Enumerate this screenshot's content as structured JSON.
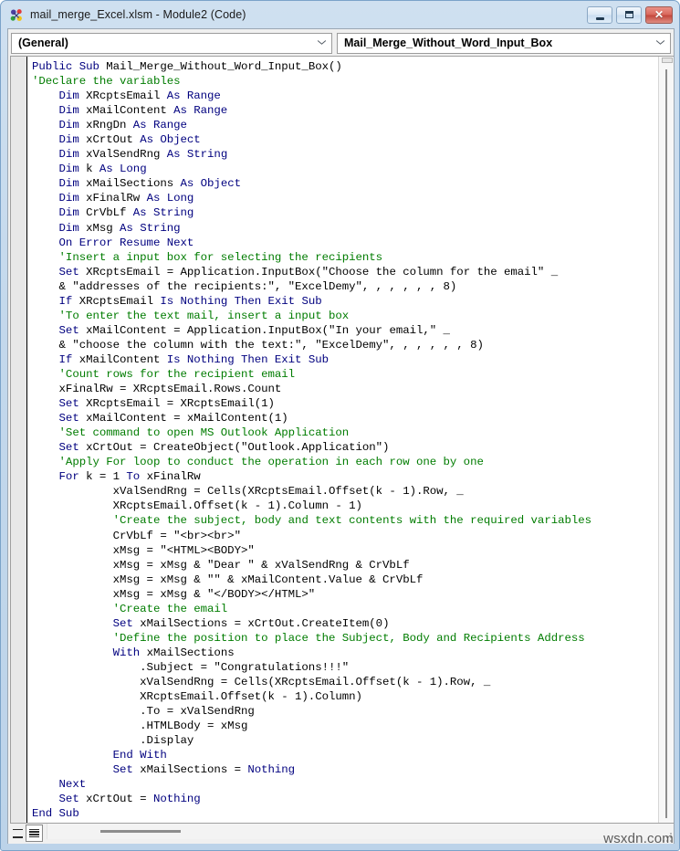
{
  "window": {
    "icon": "vba-module-icon",
    "title": "mail_merge_Excel.xlsm - Module2 (Code)",
    "buttons": {
      "minimize": "minimize-icon",
      "maximize": "maximize-icon",
      "close": "✕"
    }
  },
  "toolbar": {
    "object_combo": {
      "value": "(General)",
      "arrow": "chevron-down-icon"
    },
    "procedure_combo": {
      "value": "Mail_Merge_Without_Word_Input_Box",
      "arrow": "chevron-down-icon"
    }
  },
  "code": {
    "language": "vba",
    "colors": {
      "keyword": "#00007f",
      "comment": "#007c00",
      "identifier": "#000000",
      "background": "#ffffff"
    },
    "lines": [
      [
        {
          "t": "kw",
          "s": "Public Sub "
        },
        {
          "t": "txt",
          "s": "Mail_Merge_Without_Word_Input_Box()"
        }
      ],
      [
        {
          "t": "cmt",
          "s": "'Declare the variables"
        }
      ],
      [
        {
          "t": "txt",
          "s": "    "
        },
        {
          "t": "kw",
          "s": "Dim "
        },
        {
          "t": "txt",
          "s": "XRcptsEmail "
        },
        {
          "t": "kw",
          "s": "As Range"
        }
      ],
      [
        {
          "t": "txt",
          "s": "    "
        },
        {
          "t": "kw",
          "s": "Dim "
        },
        {
          "t": "txt",
          "s": "xMailContent "
        },
        {
          "t": "kw",
          "s": "As Range"
        }
      ],
      [
        {
          "t": "txt",
          "s": "    "
        },
        {
          "t": "kw",
          "s": "Dim "
        },
        {
          "t": "txt",
          "s": "xRngDn "
        },
        {
          "t": "kw",
          "s": "As Range"
        }
      ],
      [
        {
          "t": "txt",
          "s": "    "
        },
        {
          "t": "kw",
          "s": "Dim "
        },
        {
          "t": "txt",
          "s": "xCrtOut "
        },
        {
          "t": "kw",
          "s": "As Object"
        }
      ],
      [
        {
          "t": "txt",
          "s": "    "
        },
        {
          "t": "kw",
          "s": "Dim "
        },
        {
          "t": "txt",
          "s": "xValSendRng "
        },
        {
          "t": "kw",
          "s": "As String"
        }
      ],
      [
        {
          "t": "txt",
          "s": "    "
        },
        {
          "t": "kw",
          "s": "Dim "
        },
        {
          "t": "txt",
          "s": "k "
        },
        {
          "t": "kw",
          "s": "As Long"
        }
      ],
      [
        {
          "t": "txt",
          "s": "    "
        },
        {
          "t": "kw",
          "s": "Dim "
        },
        {
          "t": "txt",
          "s": "xMailSections "
        },
        {
          "t": "kw",
          "s": "As Object"
        }
      ],
      [
        {
          "t": "txt",
          "s": "    "
        },
        {
          "t": "kw",
          "s": "Dim "
        },
        {
          "t": "txt",
          "s": "xFinalRw "
        },
        {
          "t": "kw",
          "s": "As Long"
        }
      ],
      [
        {
          "t": "txt",
          "s": "    "
        },
        {
          "t": "kw",
          "s": "Dim "
        },
        {
          "t": "txt",
          "s": "CrVbLf "
        },
        {
          "t": "kw",
          "s": "As String"
        }
      ],
      [
        {
          "t": "txt",
          "s": "    "
        },
        {
          "t": "kw",
          "s": "Dim "
        },
        {
          "t": "txt",
          "s": "xMsg "
        },
        {
          "t": "kw",
          "s": "As String"
        }
      ],
      [
        {
          "t": "txt",
          "s": "    "
        },
        {
          "t": "kw",
          "s": "On Error Resume Next"
        }
      ],
      [
        {
          "t": "txt",
          "s": "    "
        },
        {
          "t": "cmt",
          "s": "'Insert a input box for selecting the recipients"
        }
      ],
      [
        {
          "t": "txt",
          "s": "    "
        },
        {
          "t": "kw",
          "s": "Set "
        },
        {
          "t": "txt",
          "s": "XRcptsEmail = Application.InputBox(\"Choose the column for the email\" _"
        }
      ],
      [
        {
          "t": "txt",
          "s": "    & \"addresses of the recipients:\", \"ExcelDemy\", , , , , , 8)"
        }
      ],
      [
        {
          "t": "txt",
          "s": "    "
        },
        {
          "t": "kw",
          "s": "If "
        },
        {
          "t": "txt",
          "s": "XRcptsEmail "
        },
        {
          "t": "kw",
          "s": "Is Nothing Then Exit Sub"
        }
      ],
      [
        {
          "t": "txt",
          "s": "    "
        },
        {
          "t": "cmt",
          "s": "'To enter the text mail, insert a input box"
        }
      ],
      [
        {
          "t": "txt",
          "s": "    "
        },
        {
          "t": "kw",
          "s": "Set "
        },
        {
          "t": "txt",
          "s": "xMailContent = Application.InputBox(\"In your email,\" _"
        }
      ],
      [
        {
          "t": "txt",
          "s": "    & \"choose the column with the text:\", \"ExcelDemy\", , , , , , 8)"
        }
      ],
      [
        {
          "t": "txt",
          "s": "    "
        },
        {
          "t": "kw",
          "s": "If "
        },
        {
          "t": "txt",
          "s": "xMailContent "
        },
        {
          "t": "kw",
          "s": "Is Nothing Then Exit Sub"
        }
      ],
      [
        {
          "t": "txt",
          "s": "    "
        },
        {
          "t": "cmt",
          "s": "'Count rows for the recipient email"
        }
      ],
      [
        {
          "t": "txt",
          "s": "    xFinalRw = XRcptsEmail.Rows.Count"
        }
      ],
      [
        {
          "t": "txt",
          "s": "    "
        },
        {
          "t": "kw",
          "s": "Set "
        },
        {
          "t": "txt",
          "s": "XRcptsEmail = XRcptsEmail(1)"
        }
      ],
      [
        {
          "t": "txt",
          "s": "    "
        },
        {
          "t": "kw",
          "s": "Set "
        },
        {
          "t": "txt",
          "s": "xMailContent = xMailContent(1)"
        }
      ],
      [
        {
          "t": "txt",
          "s": "    "
        },
        {
          "t": "cmt",
          "s": "'Set command to open MS Outlook Application"
        }
      ],
      [
        {
          "t": "txt",
          "s": "    "
        },
        {
          "t": "kw",
          "s": "Set "
        },
        {
          "t": "txt",
          "s": "xCrtOut = CreateObject(\"Outlook.Application\")"
        }
      ],
      [
        {
          "t": "txt",
          "s": "    "
        },
        {
          "t": "cmt",
          "s": "'Apply For loop to conduct the operation in each row one by one"
        }
      ],
      [
        {
          "t": "txt",
          "s": "    "
        },
        {
          "t": "kw",
          "s": "For "
        },
        {
          "t": "txt",
          "s": "k = 1 "
        },
        {
          "t": "kw",
          "s": "To "
        },
        {
          "t": "txt",
          "s": "xFinalRw"
        }
      ],
      [
        {
          "t": "txt",
          "s": "            xValSendRng = Cells(XRcptsEmail.Offset(k - 1).Row, _"
        }
      ],
      [
        {
          "t": "txt",
          "s": "            XRcptsEmail.Offset(k - 1).Column - 1)"
        }
      ],
      [
        {
          "t": "txt",
          "s": "            "
        },
        {
          "t": "cmt",
          "s": "'Create the subject, body and text contents with the required variables"
        }
      ],
      [
        {
          "t": "txt",
          "s": "            CrVbLf = \"<br><br>\""
        }
      ],
      [
        {
          "t": "txt",
          "s": "            xMsg = \"<HTML><BODY>\""
        }
      ],
      [
        {
          "t": "txt",
          "s": "            xMsg = xMsg & \"Dear \" & xValSendRng & CrVbLf"
        }
      ],
      [
        {
          "t": "txt",
          "s": "            xMsg = xMsg & \"\" & xMailContent.Value & CrVbLf"
        }
      ],
      [
        {
          "t": "txt",
          "s": "            xMsg = xMsg & \"</BODY></HTML>\""
        }
      ],
      [
        {
          "t": "txt",
          "s": "            "
        },
        {
          "t": "cmt",
          "s": "'Create the email"
        }
      ],
      [
        {
          "t": "txt",
          "s": "            "
        },
        {
          "t": "kw",
          "s": "Set "
        },
        {
          "t": "txt",
          "s": "xMailSections = xCrtOut.CreateItem(0)"
        }
      ],
      [
        {
          "t": "txt",
          "s": "            "
        },
        {
          "t": "cmt",
          "s": "'Define the position to place the Subject, Body and Recipients Address"
        }
      ],
      [
        {
          "t": "txt",
          "s": "            "
        },
        {
          "t": "kw",
          "s": "With "
        },
        {
          "t": "txt",
          "s": "xMailSections"
        }
      ],
      [
        {
          "t": "txt",
          "s": "                .Subject = \"Congratulations!!!\""
        }
      ],
      [
        {
          "t": "txt",
          "s": "                xValSendRng = Cells(XRcptsEmail.Offset(k - 1).Row, _"
        }
      ],
      [
        {
          "t": "txt",
          "s": "                XRcptsEmail.Offset(k - 1).Column)"
        }
      ],
      [
        {
          "t": "txt",
          "s": "                .To = xValSendRng"
        }
      ],
      [
        {
          "t": "txt",
          "s": "                .HTMLBody = xMsg"
        }
      ],
      [
        {
          "t": "txt",
          "s": "                .Display"
        }
      ],
      [
        {
          "t": "txt",
          "s": "            "
        },
        {
          "t": "kw",
          "s": "End With"
        }
      ],
      [
        {
          "t": "txt",
          "s": "            "
        },
        {
          "t": "kw",
          "s": "Set "
        },
        {
          "t": "txt",
          "s": "xMailSections = "
        },
        {
          "t": "kw",
          "s": "Nothing"
        }
      ],
      [
        {
          "t": "txt",
          "s": "    "
        },
        {
          "t": "kw",
          "s": "Next"
        }
      ],
      [
        {
          "t": "txt",
          "s": "    "
        },
        {
          "t": "kw",
          "s": "Set "
        },
        {
          "t": "txt",
          "s": "xCrtOut = "
        },
        {
          "t": "kw",
          "s": "Nothing"
        }
      ],
      [
        {
          "t": "kw",
          "s": "End Sub"
        }
      ]
    ]
  },
  "bottom": {
    "procedure_view_label": "procedure-view",
    "full_module_view_label": "full-module-view"
  },
  "watermark": "wsxdn.com"
}
